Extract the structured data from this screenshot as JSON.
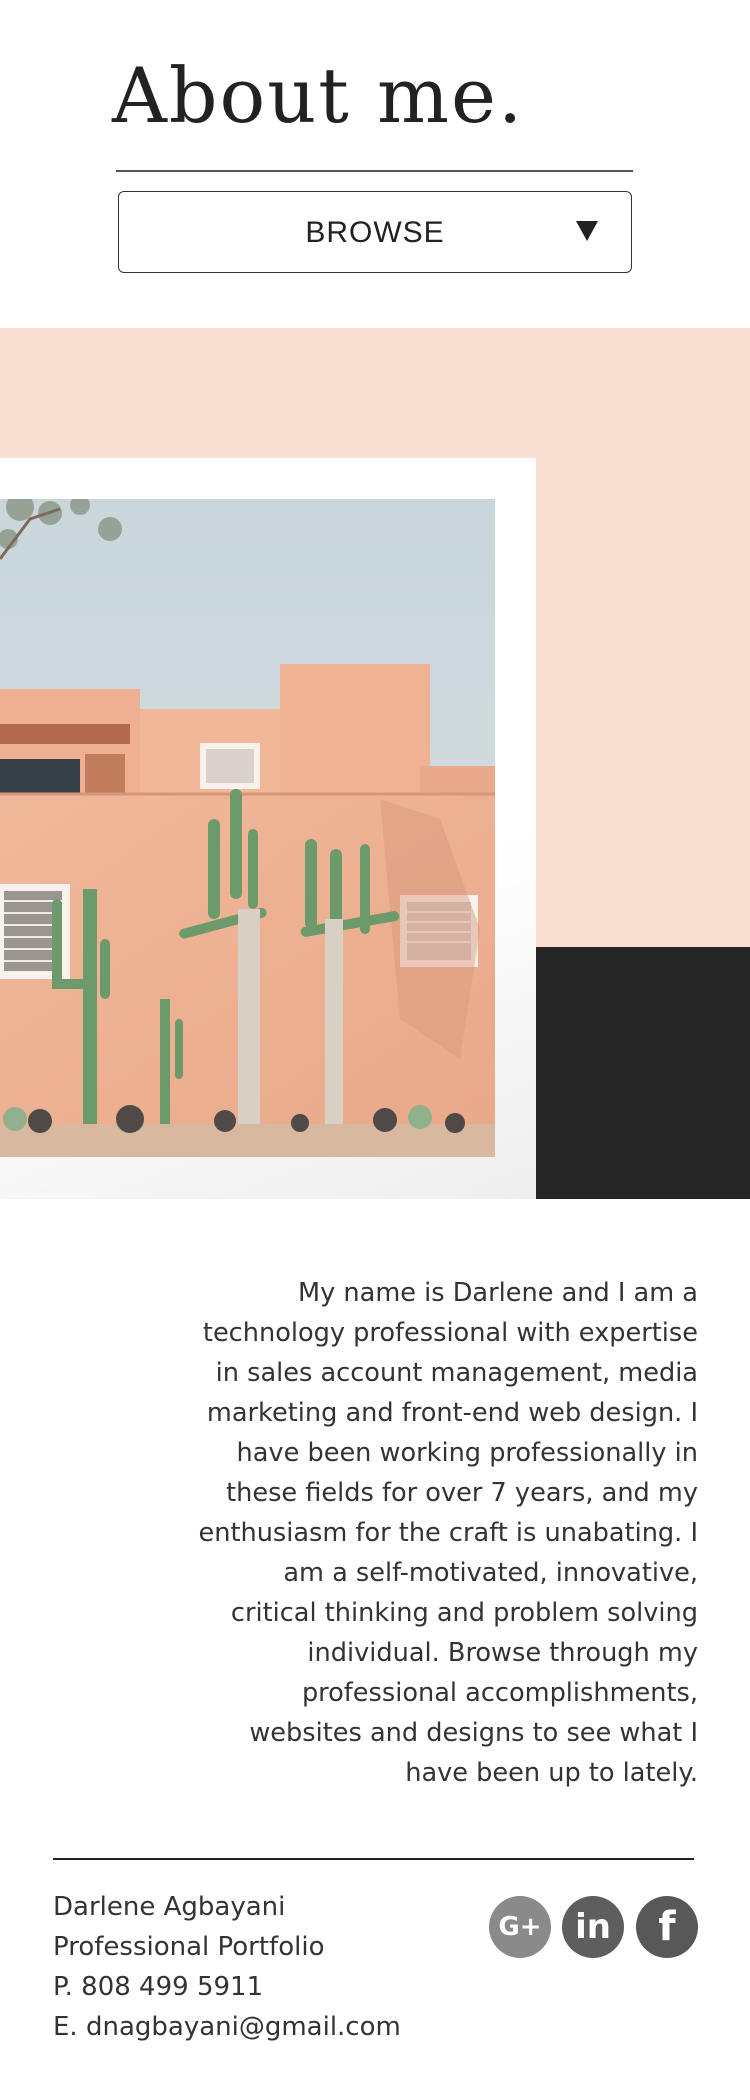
{
  "header": {
    "title": "About me.",
    "browse_label": "BROWSE",
    "browse_icon": "caret-down-icon"
  },
  "hero": {
    "photo_description_icon": "adobe-house-cactus-photo",
    "colors": {
      "peach": "#fadfd3",
      "dark": "#262626"
    }
  },
  "bio": {
    "lines": [
      "My name is Darlene and I am a",
      "technology professional with expertise",
      "in sales account management, media",
      "marketing and front-end web design. I",
      "have been working professionally in",
      "these fields for over 7 years, and my",
      "enthusiasm for the craft is unabating. I",
      "am a self-motivated, innovative,",
      "critical thinking and problem solving",
      "individual. Browse through my",
      "professional accomplishments,",
      "websites and designs to see what I",
      "have been up to lately."
    ]
  },
  "footer": {
    "name": "Darlene Agbayani",
    "subtitle": "Professional Portfolio",
    "phone": "P. 808 499 5911",
    "email": "E. dnagbayani@gmail.com",
    "social": [
      {
        "icon": "google-plus-icon",
        "glyph": "G+"
      },
      {
        "icon": "linkedin-icon",
        "glyph": "in"
      },
      {
        "icon": "facebook-icon",
        "glyph": "f"
      }
    ]
  }
}
